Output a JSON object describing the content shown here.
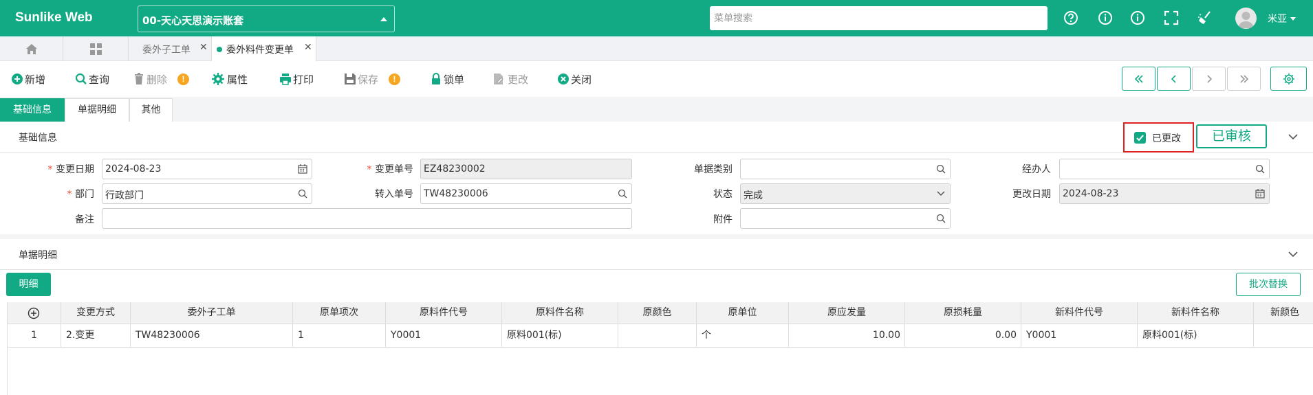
{
  "app": {
    "brand": "Sunlike Web",
    "account": "00-天心天思演示账套",
    "menu_search_placeholder": "菜单搜索",
    "user": "米亚"
  },
  "tabs": [
    {
      "label": "委外子工单",
      "active": false
    },
    {
      "label": "委外料件变更单",
      "active": true
    }
  ],
  "toolbar": {
    "add": "新增",
    "query": "查询",
    "delete": "删除",
    "props": "属性",
    "print": "打印",
    "save": "保存",
    "lock": "锁单",
    "modify": "更改",
    "close": "关闭",
    "warn_mark": "!"
  },
  "subtabs": [
    "基础信息",
    "单据明细",
    "其他"
  ],
  "basic": {
    "section_title": "基础信息",
    "modified_label": "已更改",
    "audited_label": "已审核",
    "fields": {
      "change_date": {
        "label": "变更日期",
        "value": "2024-08-23"
      },
      "change_no": {
        "label": "变更单号",
        "value": "EZ48230002"
      },
      "doc_category": {
        "label": "单据类别",
        "value": ""
      },
      "handler": {
        "label": "经办人",
        "value": ""
      },
      "department": {
        "label": "部门",
        "value": "行政部门"
      },
      "transfer_no": {
        "label": "转入单号",
        "value": "TW48230006"
      },
      "status": {
        "label": "状态",
        "value": "完成"
      },
      "modify_date": {
        "label": "更改日期",
        "value": "2024-08-23"
      },
      "remark": {
        "label": "备注",
        "value": ""
      },
      "attachment": {
        "label": "附件",
        "value": ""
      }
    },
    "required_mark": "*"
  },
  "detail": {
    "section_title": "单据明细",
    "detail_button": "明细",
    "batch_replace_button": "批次替换",
    "columns": [
      "变更方式",
      "委外子工单",
      "原单项次",
      "原料件代号",
      "原料件名称",
      "原颜色",
      "原单位",
      "原应发量",
      "原损耗量",
      "新料件代号",
      "新料件名称",
      "新颜色"
    ],
    "rows": [
      {
        "no": "1",
        "cells": [
          "2.变更",
          "TW48230006",
          "1",
          "Y0001",
          "原料001(标)",
          "",
          "个",
          "10.00",
          "0.00",
          "Y0001",
          "原料001(标)",
          ""
        ]
      }
    ]
  },
  "colors": {
    "primary": "#11aa84",
    "warn": "#f5a623",
    "highlight": "#e02020"
  }
}
